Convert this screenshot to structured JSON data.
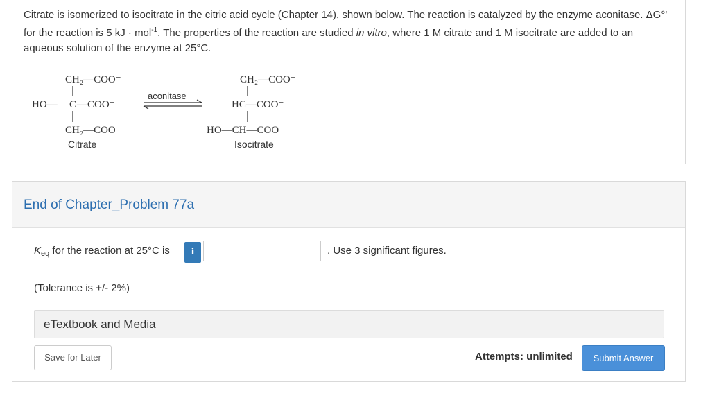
{
  "intro": {
    "part1": "Citrate is isomerized to isocitrate in the citric acid cycle (Chapter 14), shown below. The reaction is catalyzed by the enzyme aconitase. ",
    "delta_g_label": "ΔG°'",
    "part2": " for the reaction is 5 kJ · mol",
    "exponent": "-1",
    "part3": ". The properties of the reaction are studied ",
    "italic": "in vitro",
    "part4": ", where 1 M citrate and 1 M isocitrate are added to an aqueous solution of the enzyme at 25°C."
  },
  "reaction": {
    "enzyme": "aconitase",
    "citrate": {
      "line1": "CH₂—COO⁻",
      "line2_left": "HO—",
      "line2_c": "C",
      "line2_right": "—COO⁻",
      "line3": "CH₂—COO⁻",
      "name": "Citrate"
    },
    "isocitrate": {
      "line1": "CH₂—COO⁻",
      "line2": "HC—COO⁻",
      "line3": "HO—CH—COO⁻",
      "name": "Isocitrate"
    }
  },
  "problem": {
    "title": "End of Chapter_Problem 77a",
    "k_symbol": "K",
    "k_sub": "eq",
    "question_tail": " for the reaction at 25°C is",
    "info_icon_glyph": "i",
    "answer_value": "",
    "sig_figs": ". Use 3 significant figures.",
    "tolerance": "(Tolerance is +/- 2%)",
    "etextbook": "eTextbook and Media",
    "save_label": "Save for Later",
    "attempts": "Attempts: unlimited",
    "submit_label": "Submit Answer"
  }
}
